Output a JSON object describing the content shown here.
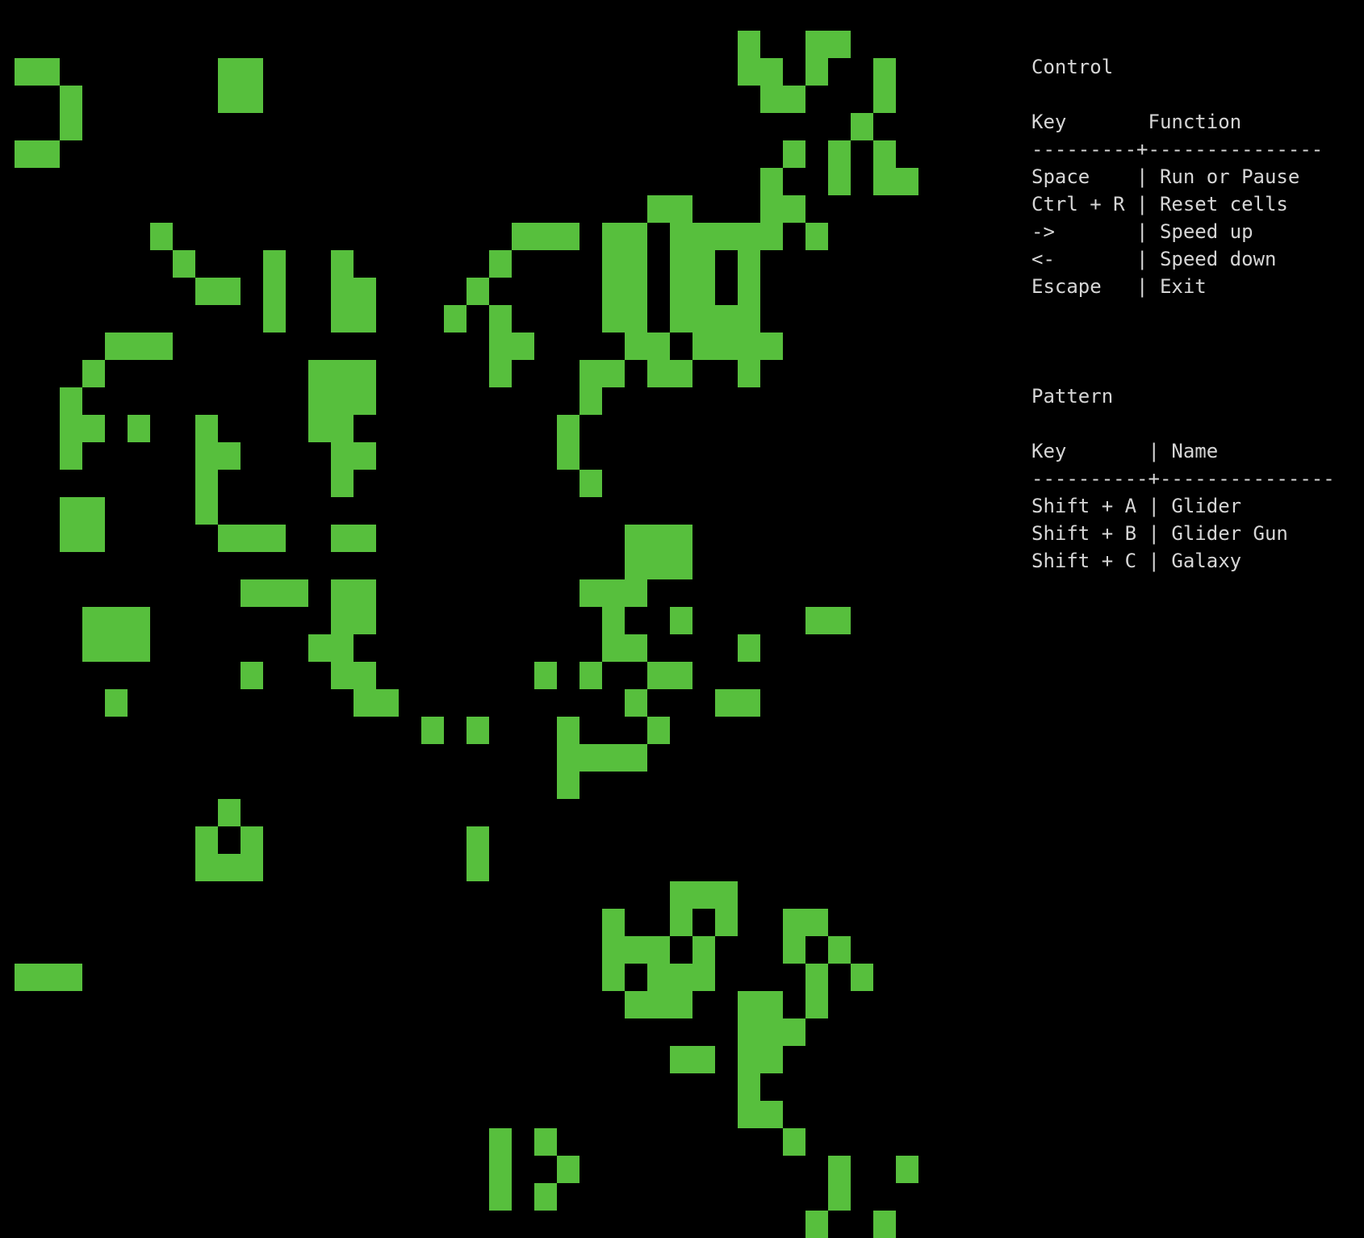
{
  "colors": {
    "background": "#000000",
    "cell_alive": "#57bf3d",
    "text": "#d6d6d6"
  },
  "grid": {
    "alive_rows": [
      "..............................................................................................................................................................................................................",
      "................................X..XX...",
      "XX.......XX.....................XX.X..X.",
      "..X......XX......................XX...X.",
      "..X..................................X..",
      "XX................................X.X.X.",
      ".................................X..X.XXX.",
      "............................XX...XX.......",
      "......X...............XXX.XX.XXXXX.X......",
      ".......X...X..X......X....XX.XX.X.........",
      "........XX.X..XX....X.....XX.XX.X.........",
      "...........X..XX...X.X....XX.XXXX.........",
      "....XXX..............XX....XX.XXXX.......",
      "...X.........XXX.....X...XX.XX..X.........",
      "..X..........XXX.........X................",
      "..XX.X..X....XX.........X.......",
      "..X.....XX....XX........X.......",
      "........X.....X..........X......",
      "..XX....X...........................",
      "..XX.....XXX..XX...........XXX.....",
      "...........................XXX.......",
      "..........XXX.XX.........XXX.........",
      "...XXX........XX..........X..X.....XX.",
      "...XXX.......XX...........XX....X....",
      "..........X...XX.......X.X..XX......",
      "....X..........XX..........X...XX.......",
      "..................X.X...X...X...........",
      "........................XXXX..........",
      "........................X.............",
      ".........X.....................",
      "........X.X.........X..........",
      "........XXX.........X..........",
      ".............................XXX...............",
      "..........................X..X.X..XX....",
      "..........................XXX.X...X.X...",
      "XXX.......................X.XXX....X.X...",
      "...........................XXX..XX.X....",
      "................................XXX.....",
      ".............................XX.XX......",
      "................................X.......",
      "................................XX......",
      ".....................X.X..........X.....",
      ".....................X..X...........X..X",
      ".....................X.X............X...",
      "...................................X..X."
    ]
  },
  "panel": {
    "control_title": "Control",
    "control_header": "Key       Function",
    "control_divider": "---------+---------------",
    "control_rows": [
      "Space    | Run or Pause",
      "Ctrl + R | Reset cells",
      "->       | Speed up",
      "<-       | Speed down",
      "Escape   | Exit"
    ],
    "pattern_title": "Pattern",
    "pattern_header": "Key       | Name",
    "pattern_divider": "----------+---------------",
    "pattern_rows": [
      "Shift + A | Glider",
      "Shift + B | Glider Gun",
      "Shift + C | Galaxy"
    ]
  }
}
